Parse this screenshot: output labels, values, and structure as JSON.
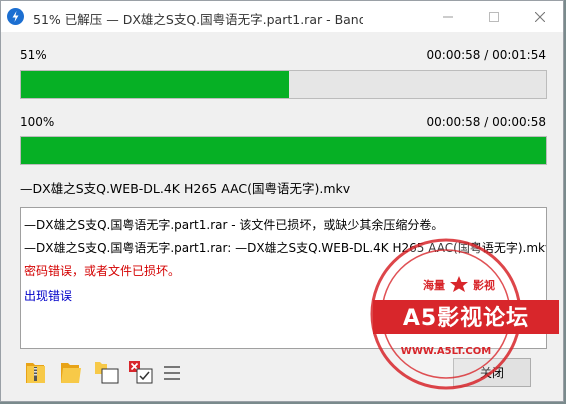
{
  "window": {
    "title": "51% 已解压 — DX雄之S支Q.国粤语无字.part1.rar - Bandizip (Stand..."
  },
  "progress_current": {
    "percent_label": "51%",
    "time_label": "00:00:58 / 00:01:54",
    "fraction": 0.51
  },
  "progress_total": {
    "percent_label": "100%",
    "time_label": "00:00:58 / 00:00:58",
    "fraction": 1.0
  },
  "current_file": "—DX雄之S支Q.WEB-DL.4K H265 AAC(国粤语无字).mkv",
  "log": {
    "lines": [
      {
        "text": "—DX雄之S支Q.国粤语无字.part1.rar - 该文件已损坏，或缺少其余压缩分卷。",
        "color": "#000000"
      },
      {
        "text": "—DX雄之S支Q.国粤语无字.part1.rar: —DX雄之S支Q.WEB-DL.4K H265 AAC(国粤语无字).mkv -",
        "color": "#000000"
      },
      {
        "text": "密码错误，或者文件已损坏。",
        "color": "#d40000"
      },
      {
        "text": "出现错误",
        "color": "#0000c8"
      }
    ]
  },
  "buttons": {
    "close_label": "关闭"
  },
  "watermark": {
    "top_text": "海量",
    "top_text2": "影视",
    "main_text": "A5影视论坛",
    "url_text": "WWW.A5LT.COM"
  },
  "colors": {
    "progress_fill": "#06b025",
    "watermark_red": "#d8262b"
  }
}
